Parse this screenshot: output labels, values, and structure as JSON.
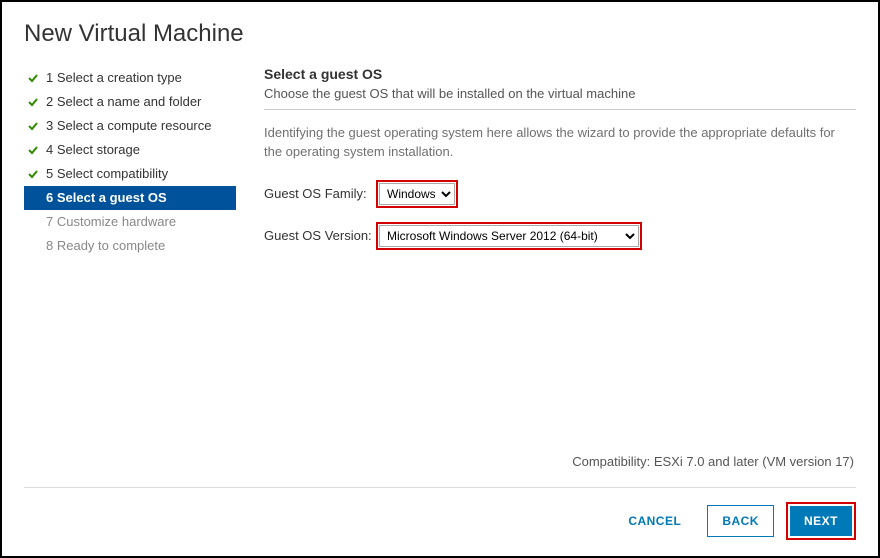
{
  "title": "New Virtual Machine",
  "steps": [
    {
      "label": "1 Select a creation type",
      "state": "done"
    },
    {
      "label": "2 Select a name and folder",
      "state": "done"
    },
    {
      "label": "3 Select a compute resource",
      "state": "done"
    },
    {
      "label": "4 Select storage",
      "state": "done"
    },
    {
      "label": "5 Select compatibility",
      "state": "done"
    },
    {
      "label": "6 Select a guest OS",
      "state": "active"
    },
    {
      "label": "7 Customize hardware",
      "state": "future"
    },
    {
      "label": "8 Ready to complete",
      "state": "future"
    }
  ],
  "panel": {
    "heading": "Select a guest OS",
    "sub": "Choose the guest OS that will be installed on the virtual machine",
    "helper": "Identifying the guest operating system here allows the wizard to provide the appropriate defaults for the operating system installation.",
    "family_label": "Guest OS Family:",
    "family_value": "Windows",
    "version_label": "Guest OS Version:",
    "version_value": "Microsoft Windows Server 2012 (64-bit)"
  },
  "compat": "Compatibility: ESXi 7.0 and later (VM version 17)",
  "buttons": {
    "cancel": "CANCEL",
    "back": "BACK",
    "next": "NEXT"
  }
}
